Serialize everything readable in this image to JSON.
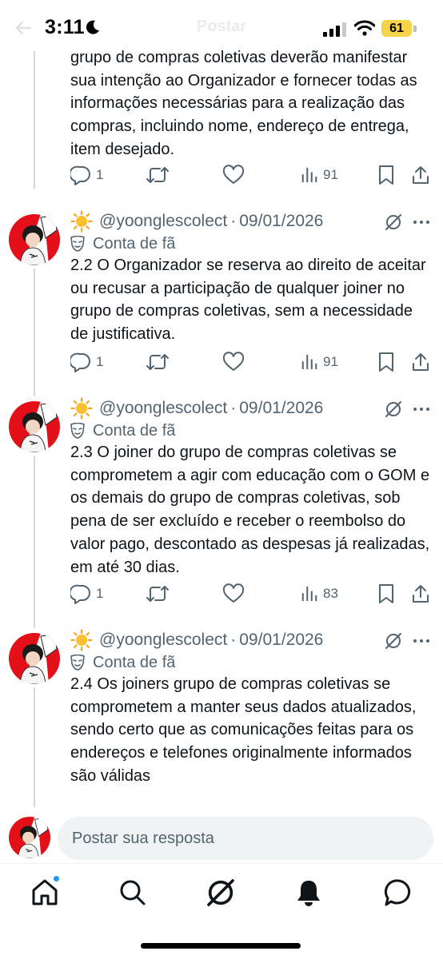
{
  "status_bar": {
    "time": "3:11",
    "battery": "61"
  },
  "header": {
    "title": "Postar"
  },
  "partial_post": {
    "text": "grupo de compras coletivas deverão manifestar sua intenção ao Organizador e fornecer todas as informações necessárias para a realização das compras, incluindo nome, endereço de entrega, item desejado.",
    "replies": "1",
    "views": "91"
  },
  "posts": [
    {
      "handle": "@yoonglescolect",
      "separator": "·",
      "date": "09/01/2026",
      "fan_label": "Conta de fã",
      "text": "2.2 O Organizador se reserva ao direito de aceitar ou recusar a participação de qualquer joiner no grupo de compras coletivas, sem a necessidade de justificativa.",
      "replies": "1",
      "views": "91"
    },
    {
      "handle": "@yoonglescolect",
      "separator": "·",
      "date": "09/01/2026",
      "fan_label": "Conta de fã",
      "text": "2.3 O joiner do grupo de compras coletivas se comprometem a agir com educação com o GOM e os demais do grupo de compras coletivas, sob pena de ser excluído e receber o reembolso do valor pago, descontado as despesas já realizadas, em até 30 dias.",
      "replies": "1",
      "views": "83"
    },
    {
      "handle": "@yoonglescolect",
      "separator": "·",
      "date": "09/01/2026",
      "fan_label": "Conta de fã",
      "text": "2.4 Os joiners grupo de compras coletivas se comprometem a manter seus dados atualizados, sendo certo que as comunicações feitas para os endereços e telefones originalmente informados são válidas"
    }
  ],
  "reply_bar": {
    "placeholder": "Postar sua resposta"
  },
  "colors": {
    "accent": "#1d9bf0",
    "text": "#0f1419",
    "muted": "#536471",
    "battery": "#f7d34a"
  },
  "icons": [
    "reply-icon",
    "repost-icon",
    "like-icon",
    "views-icon",
    "bookmark-icon",
    "share-icon",
    "grok-icon",
    "more-icon",
    "home-icon",
    "search-icon",
    "notifications-icon",
    "messages-icon"
  ]
}
